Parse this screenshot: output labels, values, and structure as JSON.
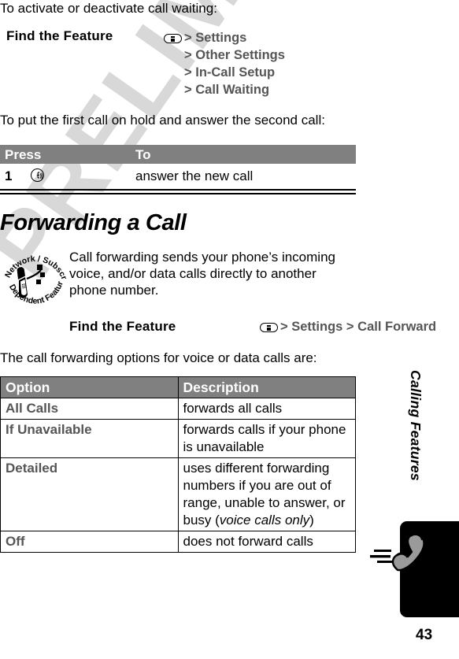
{
  "page": {
    "number": "43",
    "watermark": "PRELIMINARY",
    "side_tab_label": "Calling Features"
  },
  "intro": {
    "call_waiting_line": "To activate or deactivate call waiting:",
    "hold_line": "To put the first call on hold and answer the second call:",
    "options_line": "The call forwarding options for voice or data calls are:"
  },
  "find_feature_1": {
    "label": "Find the Feature",
    "key_icon": "menu-key-icon",
    "path": [
      "Settings",
      "Other Settings",
      "In-Call Setup",
      "Call Waiting"
    ],
    "separator": ">"
  },
  "press_table": {
    "headers": [
      "Press",
      "To"
    ],
    "rows": [
      {
        "num": "1",
        "key_icon": "send-key-icon",
        "description": "answer the new call"
      }
    ]
  },
  "section": {
    "heading": "Forwarding a Call",
    "badge": {
      "top_text": "Network / Subscription",
      "bottom_text": "Dependent Feature",
      "icon": "flip-phone-signal-icon"
    },
    "paragraph": "Call forwarding sends your phone’s incoming voice, and/or data calls directly to another phone number."
  },
  "find_feature_2": {
    "label": "Find the Feature",
    "key_icon": "menu-key-icon",
    "path": [
      "Settings",
      "Call Forward"
    ],
    "separator": ">"
  },
  "options_table": {
    "headers": [
      "Option",
      "Description"
    ],
    "rows": [
      {
        "option": "All Calls",
        "description": "forwards all calls",
        "italic_tail": ""
      },
      {
        "option": "If Unavailable",
        "description": "forwards calls if your phone is unavailable",
        "italic_tail": ""
      },
      {
        "option": "Detailed",
        "description": "uses different forwarding numbers if you are out of range, unable to answer, or busy (",
        "italic_tail": "voice calls only",
        "description_close": ")"
      },
      {
        "option": "Off",
        "description": "does not forward calls",
        "italic_tail": ""
      }
    ]
  },
  "colors": {
    "header_gray": "#808080",
    "menu_text_gray": "#555555",
    "watermark_gray": "#d8d8d8",
    "tab_black": "#000000",
    "handset_gray": "#9a9a9a"
  }
}
